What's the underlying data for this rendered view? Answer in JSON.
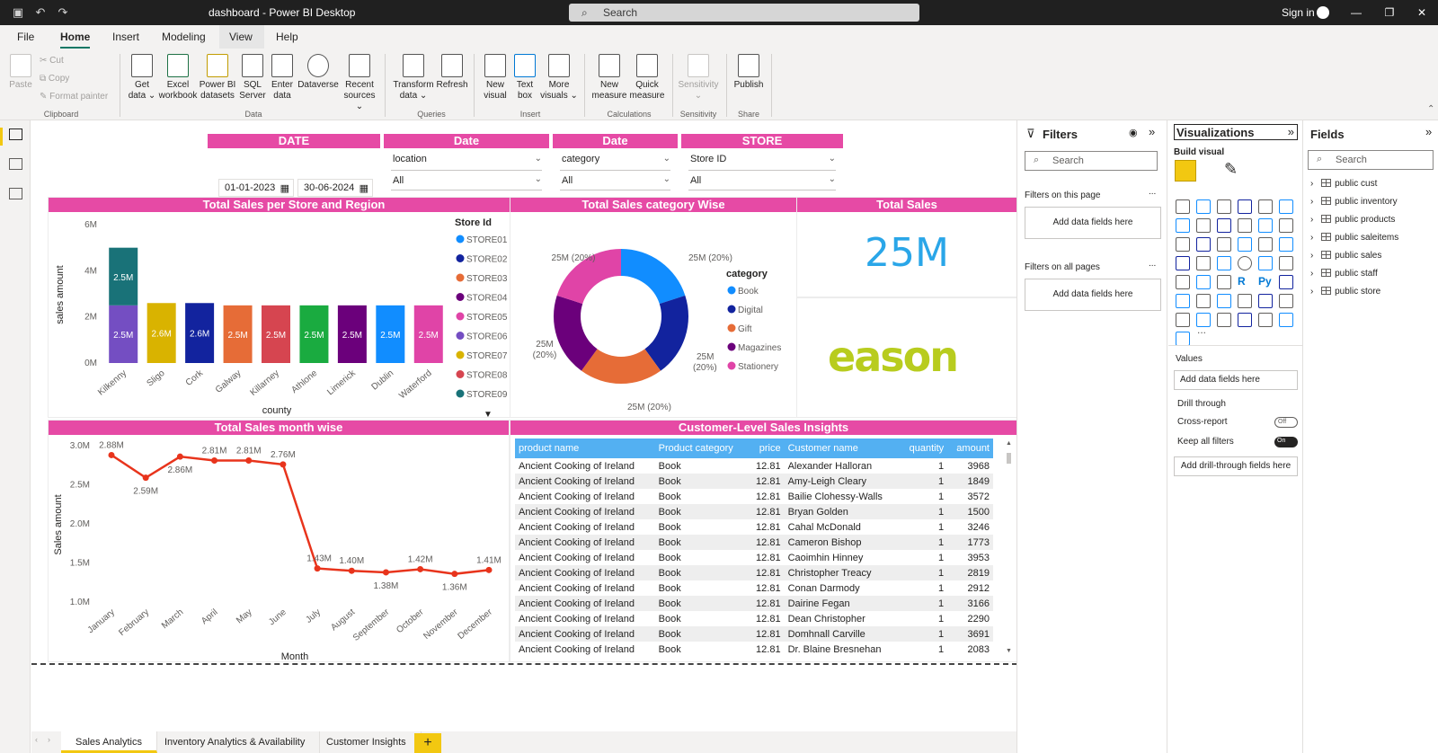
{
  "window": {
    "title": "dashboard - Power BI Desktop",
    "search_placeholder": "Search",
    "sign_in": "Sign in"
  },
  "menu": {
    "tabs": [
      "File",
      "Home",
      "Insert",
      "Modeling",
      "View",
      "Help"
    ],
    "active": "Home"
  },
  "ribbon": {
    "clipboard": {
      "paste": "Paste",
      "cut": "Cut",
      "copy": "Copy",
      "format_painter": "Format painter",
      "group": "Clipboard"
    },
    "data": {
      "get_data": [
        "Get",
        "data ⌄"
      ],
      "excel": [
        "Excel",
        "workbook"
      ],
      "pbi_datasets": [
        "Power BI",
        "datasets"
      ],
      "sql": [
        "SQL",
        "Server"
      ],
      "enter_data": [
        "Enter",
        "data"
      ],
      "dataverse": "Dataverse",
      "recent": [
        "Recent",
        "sources ⌄"
      ],
      "group": "Data"
    },
    "queries": {
      "transform": [
        "Transform",
        "data ⌄"
      ],
      "refresh": "Refresh",
      "group": "Queries"
    },
    "insert": {
      "new_visual": [
        "New",
        "visual"
      ],
      "text_box": [
        "Text",
        "box"
      ],
      "more_visuals": [
        "More",
        "visuals ⌄"
      ],
      "group": "Insert"
    },
    "calculations": {
      "new_measure": [
        "New",
        "measure"
      ],
      "quick_measure": [
        "Quick",
        "measure"
      ],
      "group": "Calculations"
    },
    "sensitivity": {
      "label": "Sensitivity",
      "sub": "⌄",
      "group": "Sensitivity"
    },
    "share": {
      "publish": "Publish",
      "group": "Share"
    }
  },
  "slicers": {
    "date_range": {
      "header": "DATE",
      "from": "01-01-2023",
      "to": "30-06-2024"
    },
    "location": {
      "header": "Date",
      "label": "location",
      "value": "All"
    },
    "category": {
      "header": "Date",
      "label": "category",
      "value": "All"
    },
    "store": {
      "header": "STORE",
      "label": "Store ID",
      "value": "All"
    }
  },
  "visuals": {
    "store_region": {
      "title": "Total Sales per Store and Region",
      "legend_title": "Store Id"
    },
    "category_donut": {
      "title": "Total Sales category Wise",
      "legend_title": "category"
    },
    "total_sales": {
      "title": "Total Sales",
      "value": "25M",
      "logo_text": "eason"
    },
    "month_wise": {
      "title": "Total Sales month wise"
    },
    "customer_table": {
      "title": "Customer-Level Sales Insights"
    }
  },
  "colors": {
    "header_pink": "#e64aa5",
    "kpi_blue": "#2aa6e8",
    "line_red": "#e8341c",
    "table_header": "#53b0f2",
    "logo_green": "#b8cc1e"
  },
  "chart_data": [
    {
      "type": "bar",
      "stacked": true,
      "title": "Total Sales per Store and Region",
      "xlabel": "county",
      "ylabel": "sales amount",
      "ylim": [
        0,
        6
      ],
      "y_ticks": [
        "0M",
        "2M",
        "4M",
        "6M"
      ],
      "categories": [
        "Kilkenny",
        "Sligo",
        "Cork",
        "Galway",
        "Killarney",
        "Athlone",
        "Limerick",
        "Dublin",
        "Waterford"
      ],
      "series": [
        {
          "name": "STORE01",
          "color": "#118dff",
          "values": [
            0,
            0,
            0,
            0,
            0,
            0,
            0,
            2.5,
            0
          ]
        },
        {
          "name": "STORE02",
          "color": "#12239e",
          "values": [
            0,
            0,
            2.6,
            0,
            0,
            0,
            0,
            0,
            0
          ]
        },
        {
          "name": "STORE03",
          "color": "#e66c37",
          "values": [
            0,
            0,
            0,
            2.5,
            0,
            0,
            0,
            0,
            0
          ]
        },
        {
          "name": "STORE04",
          "color": "#6b007b",
          "values": [
            0,
            0,
            0,
            0,
            0,
            0,
            2.5,
            0,
            0
          ]
        },
        {
          "name": "STORE05",
          "color": "#e044a7",
          "values": [
            0,
            0,
            0,
            0,
            0,
            0,
            0,
            0,
            2.5
          ]
        },
        {
          "name": "STORE06",
          "color": "#744ec2",
          "values": [
            2.5,
            0,
            0,
            0,
            0,
            0,
            0,
            0,
            0
          ]
        },
        {
          "name": "STORE07",
          "color": "#d9b300",
          "values": [
            0,
            2.6,
            0,
            0,
            0,
            0,
            0,
            0,
            0
          ]
        },
        {
          "name": "STORE08",
          "color": "#d64550",
          "values": [
            0,
            0,
            0,
            0,
            2.5,
            0,
            0,
            0,
            0
          ]
        },
        {
          "name": "STORE09",
          "color": "#197278",
          "values": [
            2.5,
            0,
            0,
            0,
            0,
            0,
            0,
            0,
            0
          ]
        },
        {
          "name": "",
          "color": "#1aab40",
          "values": [
            0,
            0,
            0,
            0,
            0,
            2.5,
            0,
            0,
            0
          ]
        }
      ],
      "bar_labels": [
        [
          "2.5M",
          "2.5M"
        ],
        [
          "2.6M"
        ],
        [
          "2.6M"
        ],
        [
          "2.5M"
        ],
        [
          "2.5M"
        ],
        [
          "2.5M"
        ],
        [
          "2.5M"
        ],
        [
          "2.5M"
        ],
        [
          "2.5M"
        ]
      ]
    },
    {
      "type": "pie",
      "donut": true,
      "title": "Total Sales category Wise",
      "categories": [
        "Book",
        "Digital",
        "Gift",
        "Magazines",
        "Stationery"
      ],
      "values": [
        20,
        20,
        20,
        20,
        20
      ],
      "colors": [
        "#118dff",
        "#12239e",
        "#e66c37",
        "#6b007b",
        "#e044a7"
      ],
      "labels": [
        "25M (20%)",
        "25M (20%)",
        "25M (20%)",
        "25M (20%)",
        "25M (20%)"
      ]
    },
    {
      "type": "line",
      "title": "Total Sales month wise",
      "xlabel": "Month",
      "ylabel": "Sales amount",
      "ylim": [
        1.0,
        3.0
      ],
      "y_ticks": [
        "1.0M",
        "1.5M",
        "2.0M",
        "2.5M",
        "3.0M"
      ],
      "categories": [
        "January",
        "February",
        "March",
        "April",
        "May",
        "June",
        "July",
        "August",
        "September",
        "October",
        "November",
        "December"
      ],
      "values": [
        2.88,
        2.59,
        2.86,
        2.81,
        2.81,
        2.76,
        1.43,
        1.4,
        1.38,
        1.42,
        1.36,
        1.41
      ],
      "labels": [
        "2.88M",
        "2.59M",
        "2.86M",
        "2.81M",
        "2.81M",
        "2.76M",
        "1.43M",
        "1.40M",
        "1.38M",
        "1.42M",
        "1.36M",
        "1.41M"
      ]
    },
    {
      "type": "table",
      "title": "Customer-Level Sales Insights",
      "columns": [
        "product name",
        "Product category",
        "price",
        "Customer name",
        "quantity",
        "amount"
      ],
      "rows": [
        [
          "Ancient Cooking of Ireland",
          "Book",
          "12.81",
          "Alexander Halloran",
          "1",
          "3968"
        ],
        [
          "Ancient Cooking of Ireland",
          "Book",
          "12.81",
          "Amy-Leigh Cleary",
          "1",
          "1849"
        ],
        [
          "Ancient Cooking of Ireland",
          "Book",
          "12.81",
          "Bailie Clohessy-Walls",
          "1",
          "3572"
        ],
        [
          "Ancient Cooking of Ireland",
          "Book",
          "12.81",
          "Bryan Golden",
          "1",
          "1500"
        ],
        [
          "Ancient Cooking of Ireland",
          "Book",
          "12.81",
          "Cahal McDonald",
          "1",
          "3246"
        ],
        [
          "Ancient Cooking of Ireland",
          "Book",
          "12.81",
          "Cameron Bishop",
          "1",
          "1773"
        ],
        [
          "Ancient Cooking of Ireland",
          "Book",
          "12.81",
          "Caoimhin Hinney",
          "1",
          "3953"
        ],
        [
          "Ancient Cooking of Ireland",
          "Book",
          "12.81",
          "Christopher Treacy",
          "1",
          "2819"
        ],
        [
          "Ancient Cooking of Ireland",
          "Book",
          "12.81",
          "Conan Darmody",
          "1",
          "2912"
        ],
        [
          "Ancient Cooking of Ireland",
          "Book",
          "12.81",
          "Dairine Fegan",
          "1",
          "3166"
        ],
        [
          "Ancient Cooking of Ireland",
          "Book",
          "12.81",
          "Dean Christopher",
          "1",
          "2290"
        ],
        [
          "Ancient Cooking of Ireland",
          "Book",
          "12.81",
          "Domhnall Carville",
          "1",
          "3691"
        ],
        [
          "Ancient Cooking of Ireland",
          "Book",
          "12.81",
          "Dr. Blaine Bresnehan",
          "1",
          "2083"
        ]
      ]
    }
  ],
  "page_tabs": [
    "Sales Analytics",
    "Inventory Analytics & Availability",
    "Customer Insights"
  ],
  "active_page": "Sales Analytics",
  "filters_pane": {
    "title": "Filters",
    "search": "Search",
    "on_this_page": "Filters on this page",
    "on_all_pages": "Filters on all pages",
    "add_fields": "Add data fields here",
    "more": "..."
  },
  "viz_pane": {
    "title": "Visualizations",
    "build_visual": "Build visual",
    "values": "Values",
    "values_drop": "Add data fields here",
    "drill_through": "Drill through",
    "cross_report": "Cross-report",
    "cross_report_state": "Off",
    "keep_all_filters": "Keep all filters",
    "keep_all_filters_state": "On",
    "drill_drop": "Add drill-through fields here",
    "more": "...",
    "r_label": "R",
    "py_label": "Py"
  },
  "fields_pane": {
    "title": "Fields",
    "search": "Search",
    "tables": [
      "public cust",
      "public inventory",
      "public products",
      "public saleitems",
      "public sales",
      "public staff",
      "public store"
    ]
  }
}
